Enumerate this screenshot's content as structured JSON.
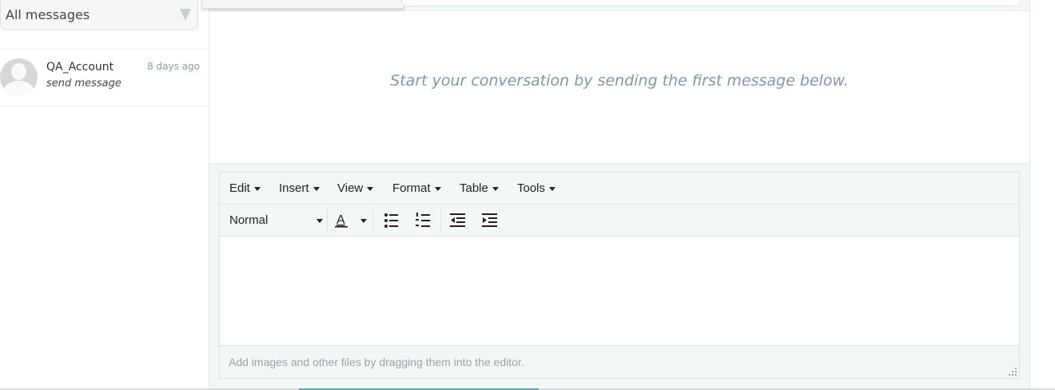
{
  "filter": {
    "selected": "All messages"
  },
  "conversations": [
    {
      "name": "QA_Account",
      "preview": "send message",
      "time": "8 days ago"
    }
  ],
  "messages": {
    "empty_state": "Start your conversation by sending the first message below."
  },
  "editor": {
    "menus": [
      "Edit",
      "Insert",
      "View",
      "Format",
      "Table",
      "Tools"
    ],
    "block_format": "Normal",
    "text_color_glyph": "A",
    "status_hint": "Add images and other files by dragging them into the editor."
  },
  "colors": {
    "accent": "#7f97a8",
    "bottom_accent": "#5fa7b2"
  },
  "icons": [
    "chevron-down-icon",
    "person-avatar-icon",
    "text-color-icon",
    "bullet-list-icon",
    "numbered-list-icon",
    "outdent-icon",
    "indent-icon",
    "resize-handle-icon"
  ]
}
